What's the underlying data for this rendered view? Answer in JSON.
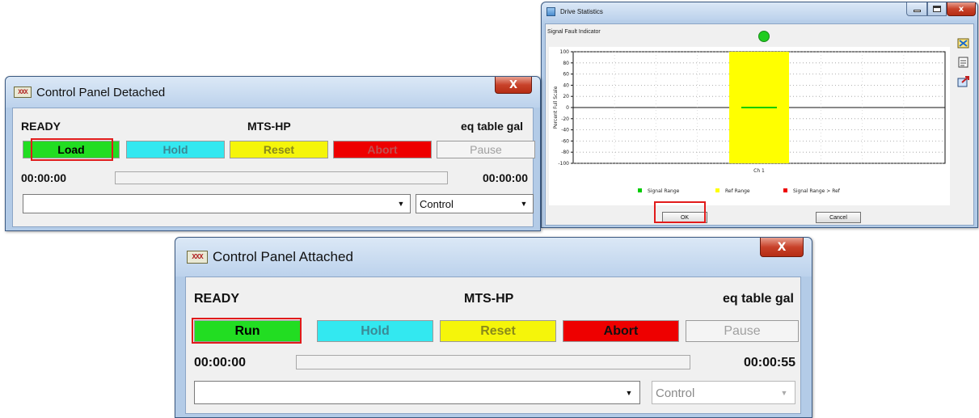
{
  "detached": {
    "title": "Control Panel Detached",
    "app_icon": "XXX",
    "close": "X",
    "status": "READY",
    "station": "MTS-HP",
    "table": "eq table gal",
    "buttons": {
      "load": "Load",
      "hold": "Hold",
      "reset": "Reset",
      "abort": "Abort",
      "pause": "Pause"
    },
    "time_left": "00:00:00",
    "time_right": "00:00:00",
    "progress": 0,
    "combo_left": "",
    "combo_right": "Control"
  },
  "attached": {
    "title": "Control Panel Attached",
    "app_icon": "XXX",
    "close": "X",
    "status": "READY",
    "station": "MTS-HP",
    "table": "eq table gal",
    "buttons": {
      "run": "Run",
      "hold": "Hold",
      "reset": "Reset",
      "abort": "Abort",
      "pause": "Pause"
    },
    "time_left": "00:00:00",
    "time_right": "00:00:55",
    "progress": 0,
    "combo_left": "",
    "combo_right": "Control"
  },
  "drive_stats": {
    "title": "Drive Statistics",
    "indicator_label": "Signal Fault Indicator",
    "ylabel": "Percent Full Scale",
    "xlabel": "Ch 1",
    "ok": "OK",
    "cancel": "Cancel",
    "tools": [
      "chart-edit-icon",
      "chart-props-icon",
      "chart-export-icon"
    ]
  },
  "colors": {
    "load_green": "#22dd22",
    "hold_cyan": "#33e8f0",
    "reset_yellow": "#f5f50a",
    "abort_red": "#ee0000",
    "highlight_red": "#e11b1b",
    "indicator_green": "#1fcc1f"
  },
  "chart_data": {
    "type": "bar",
    "categories": [
      "Ch 1"
    ],
    "series": [
      {
        "name": "Signal Range",
        "color": "#00cc00",
        "values": [
          [
            -1,
            1
          ]
        ]
      },
      {
        "name": "Ref Range",
        "color": "#ffff00",
        "values": [
          [
            -100,
            100
          ]
        ]
      },
      {
        "name": "Signal Range > Ref",
        "color": "#ee0000",
        "values": [
          null
        ]
      }
    ],
    "yticks": [
      "100",
      "80",
      "60",
      "40",
      "20",
      "0",
      "-20",
      "-40",
      "-60",
      "-80",
      "-100"
    ],
    "ylim": [
      -100,
      100
    ],
    "ylabel": "Percent Full Scale",
    "xlabel": "Ch 1",
    "grid": true,
    "legend": "bottom"
  }
}
